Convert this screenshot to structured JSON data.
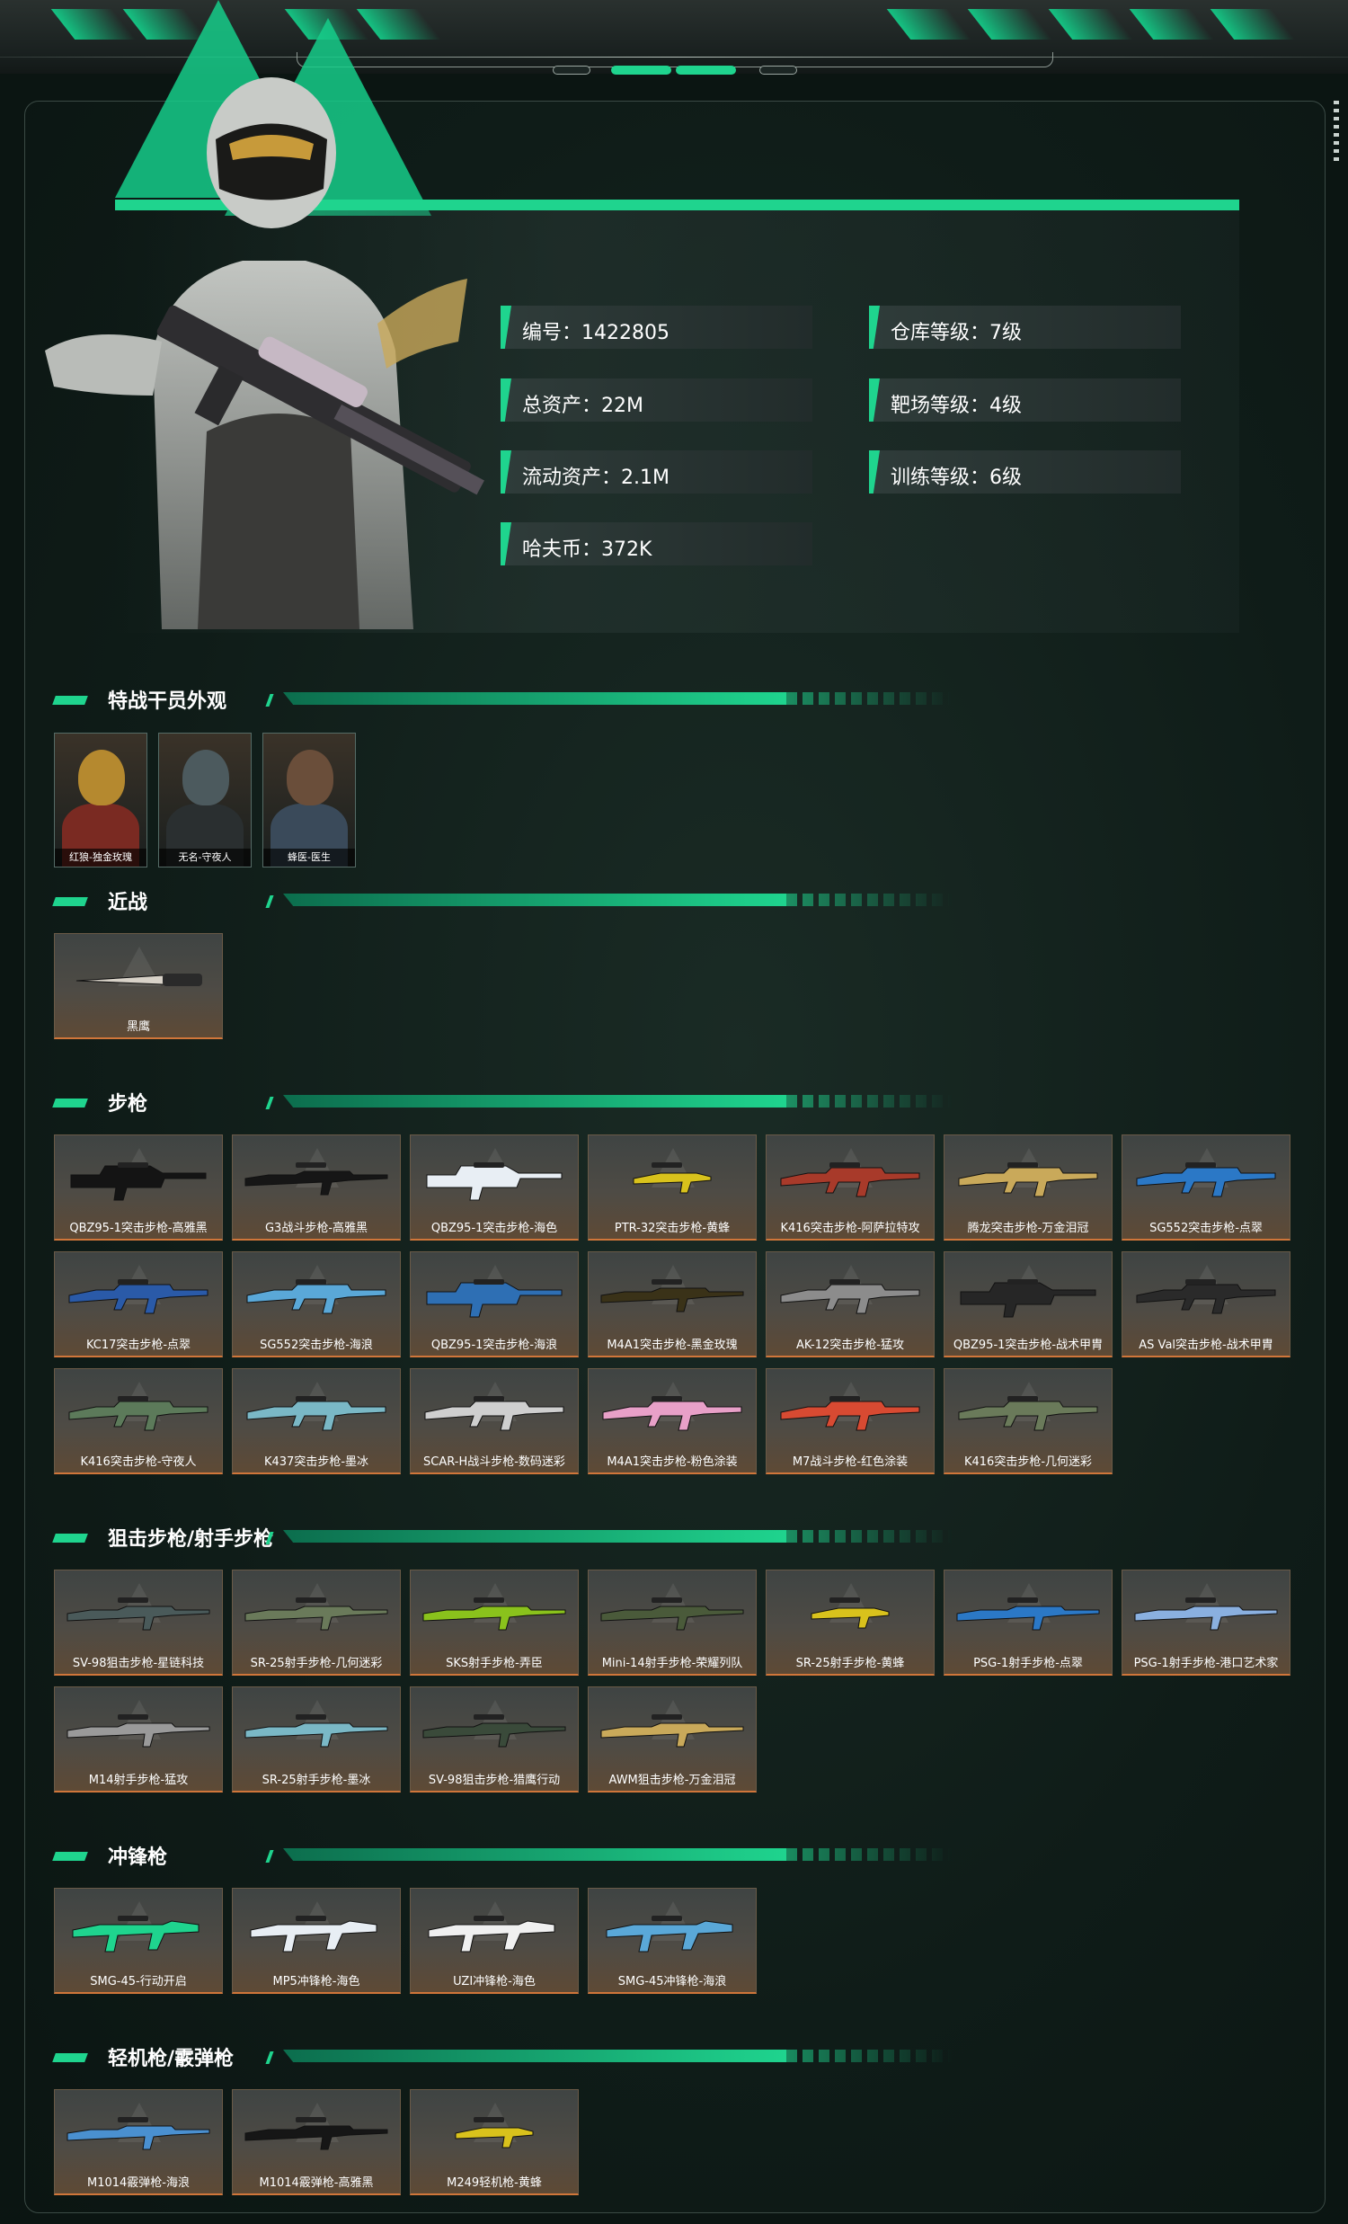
{
  "profile": {
    "stats": [
      {
        "label": "编号：1422805"
      },
      {
        "label": "仓库等级：7级"
      },
      {
        "label": "总资产：22M"
      },
      {
        "label": "靶场等级：4级"
      },
      {
        "label": "流动资产：2.1M"
      },
      {
        "label": "训练等级：6级"
      },
      {
        "label": "哈夫币：372K"
      }
    ]
  },
  "sections": {
    "operators": {
      "title": "特战干员外观",
      "items": [
        {
          "label": "红狼-独金玫瑰",
          "color": "#b5892f"
        },
        {
          "label": "无名-守夜人",
          "color": "#4c5a5e"
        },
        {
          "label": "蜂医-医生",
          "color": "#6a4e3a"
        }
      ]
    },
    "melee": {
      "title": "近战",
      "items": [
        {
          "label": "黑鹰",
          "color": "#d8d2c8",
          "kind": "knife"
        }
      ]
    },
    "rifles": {
      "title": "步枪",
      "items": [
        {
          "label": "QBZ95-1突击步枪-高雅黑",
          "color": "#141414",
          "kind": "bullpup"
        },
        {
          "label": "G3战斗步枪-高雅黑",
          "color": "#161616",
          "kind": "long"
        },
        {
          "label": "QBZ95-1突击步枪-海色",
          "color": "#e8eef4",
          "kind": "bullpup"
        },
        {
          "label": "PTR-32突击步枪-黄蜂",
          "color": "#d9c21c",
          "kind": "short"
        },
        {
          "label": "K416突击步枪-阿萨拉特攻",
          "color": "#a83a2a",
          "kind": "ar"
        },
        {
          "label": "腾龙突击步枪-万金泪冠",
          "color": "#c9a95a",
          "kind": "ar"
        },
        {
          "label": "SG552突击步枪-点翠",
          "color": "#2b78c6",
          "kind": "ar"
        },
        {
          "label": "KC17突击步枪-点翠",
          "color": "#2a5aa8",
          "kind": "ar"
        },
        {
          "label": "SG552突击步枪-海浪",
          "color": "#5aa8d8",
          "kind": "ar"
        },
        {
          "label": "QBZ95-1突击步枪-海浪",
          "color": "#2e6fb4",
          "kind": "bullpup"
        },
        {
          "label": "M4A1突击步枪-黑金玫瑰",
          "color": "#3a3218",
          "kind": "long"
        },
        {
          "label": "AK-12突击步枪-猛攻",
          "color": "#8c8c8c",
          "kind": "ar"
        },
        {
          "label": "QBZ95-1突击步枪-战术甲胄",
          "color": "#262626",
          "kind": "bullpup"
        },
        {
          "label": "AS Val突击步枪-战术甲胄",
          "color": "#2a2a2a",
          "kind": "ar"
        },
        {
          "label": "K416突击步枪-守夜人",
          "color": "#5c7a5a",
          "kind": "ar"
        },
        {
          "label": "K437突击步枪-墨冰",
          "color": "#7ab8c6",
          "kind": "ar"
        },
        {
          "label": "SCAR-H战斗步枪-数码迷彩",
          "color": "#cfcfcf",
          "kind": "ar"
        },
        {
          "label": "M4A1突击步枪-粉色涂装",
          "color": "#e8a0c8",
          "kind": "ar"
        },
        {
          "label": "M7战斗步枪-红色涂装",
          "color": "#d84a32",
          "kind": "ar"
        },
        {
          "label": "K416突击步枪-几何迷彩",
          "color": "#6a7a5a",
          "kind": "ar"
        }
      ]
    },
    "snipers": {
      "title": "狙击步枪/射手步枪",
      "items": [
        {
          "label": "SV-98狙击步枪-星链科技",
          "color": "#4a5a5a",
          "kind": "long"
        },
        {
          "label": "SR-25射手步枪-几何迷彩",
          "color": "#6a7a5a",
          "kind": "long"
        },
        {
          "label": "SKS射手步枪-弄臣",
          "color": "#8ac21c",
          "kind": "long"
        },
        {
          "label": "Mini-14射手步枪-荣耀列队",
          "color": "#4a5a3a",
          "kind": "long"
        },
        {
          "label": "SR-25射手步枪-黄蜂",
          "color": "#d9c21c",
          "kind": "short"
        },
        {
          "label": "PSG-1射手步枪-点翠",
          "color": "#2b78c6",
          "kind": "long"
        },
        {
          "label": "PSG-1射手步枪-港口艺术家",
          "color": "#8ab0e0",
          "kind": "long"
        },
        {
          "label": "M14射手步枪-猛攻",
          "color": "#9a9a9a",
          "kind": "long"
        },
        {
          "label": "SR-25射手步枪-墨冰",
          "color": "#7ab8c6",
          "kind": "long"
        },
        {
          "label": "SV-98狙击步枪-猎鹰行动",
          "color": "#3a4a3a",
          "kind": "long"
        },
        {
          "label": "AWM狙击步枪-万金泪冠",
          "color": "#c9a95a",
          "kind": "long"
        }
      ]
    },
    "smgs": {
      "title": "冲锋枪",
      "items": [
        {
          "label": "SMG-45-行动开启",
          "color": "#1fd48e",
          "kind": "smg"
        },
        {
          "label": "MP5冲锋枪-海色",
          "color": "#e8eef4",
          "kind": "smg"
        },
        {
          "label": "UZI冲锋枪-海色",
          "color": "#f0f0f0",
          "kind": "smg"
        },
        {
          "label": "SMG-45冲锋枪-海浪",
          "color": "#5aa8d8",
          "kind": "smg"
        }
      ]
    },
    "lmgs": {
      "title": "轻机枪/霰弹枪",
      "items": [
        {
          "label": "M1014霰弹枪-海浪",
          "color": "#4a90d0",
          "kind": "long"
        },
        {
          "label": "M1014霰弹枪-高雅黑",
          "color": "#161616",
          "kind": "long"
        },
        {
          "label": "M249轻机枪-黄蜂",
          "color": "#d9c21c",
          "kind": "short"
        }
      ]
    }
  }
}
